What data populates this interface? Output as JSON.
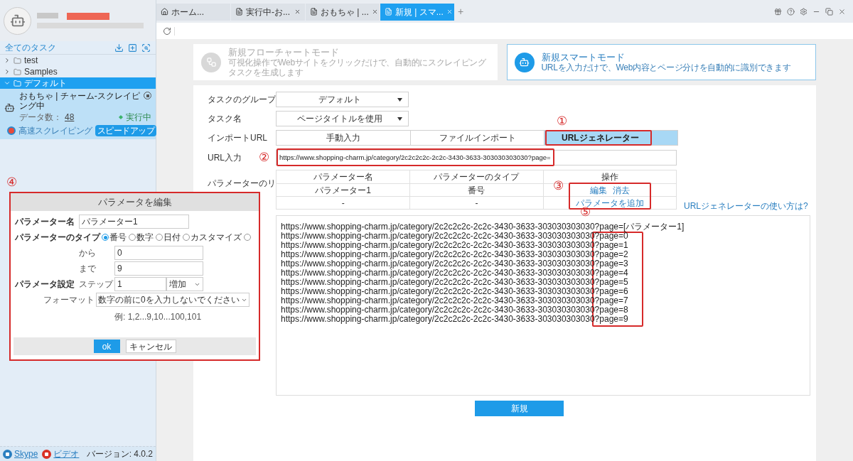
{
  "tabs": [
    {
      "label": "ホーム...",
      "kind": "home",
      "closable": false,
      "selected": false
    },
    {
      "label": "実行中-お...",
      "kind": "page",
      "closable": true,
      "selected": false
    },
    {
      "label": "おもちゃ | ...",
      "kind": "page",
      "closable": true,
      "selected": false
    },
    {
      "label": "新規 | スマ...",
      "kind": "page",
      "closable": true,
      "selected": true
    }
  ],
  "new_tab": "+",
  "sidebar": {
    "title": "全てのタスク",
    "folders": [
      {
        "label": "test",
        "expanded": false,
        "selected": false
      },
      {
        "label": "Samples",
        "expanded": false,
        "selected": false
      },
      {
        "label": "デフォルト",
        "expanded": true,
        "selected": true
      }
    ],
    "task": {
      "title": "おもちゃ | チャーム-スクレイピング中",
      "data_label": "データ数：",
      "data_count": "48",
      "status": "実行中",
      "speed_label": "高速スクレイピング",
      "speed_button": "スピードアップ"
    },
    "footer": {
      "links": [
        "Skype",
        "ビデオ"
      ],
      "version": "バージョン: 4.0.2"
    }
  },
  "modes": [
    {
      "title": "新規フローチャートモード",
      "subtitle": "可視化操作でWebサイトをクリックだけで、自動的にスクレイピングタスクを生成します",
      "selected": false
    },
    {
      "title": "新規スマートモード",
      "subtitle": "URLを入力だけで、Web内容とページ分けを自動的に識別できます",
      "selected": true
    }
  ],
  "form": {
    "group": {
      "label": "タスクのグループ",
      "value": "デフォルト"
    },
    "task_name": {
      "label": "タスク名",
      "value": "ページタイトルを使用"
    },
    "import_url": {
      "label": "インポートURL",
      "options": [
        {
          "label": "手動入力",
          "selected": false
        },
        {
          "label": "ファイルインポート",
          "selected": false
        },
        {
          "label": "URLジェネレーター",
          "selected": true
        }
      ]
    },
    "url_input": {
      "label": "URL入力",
      "value": "https://www.shopping-charm.jp/category/2c2c2c2c-2c2c-3430-3633-303030303030?page="
    },
    "params": {
      "label": "パラメーターのリ",
      "columns": [
        "パラメーター名",
        "パラメーターのタイプ",
        "操作"
      ],
      "rows": [
        {
          "cells": [
            "パラメーター1",
            "番号"
          ],
          "actions": [
            "編集",
            "消去"
          ]
        },
        {
          "cells": [
            "-",
            "-"
          ],
          "actions": [
            "パラメータを追加"
          ]
        }
      ]
    },
    "help_link": "URLジェネレーターの使い方は?",
    "output_lines": [
      "https://www.shopping-charm.jp/category/2c2c2c2c-2c2c-3430-3633-303030303030?page=[パラメーター1]",
      "https://www.shopping-charm.jp/category/2c2c2c2c-2c2c-3430-3633-303030303030?page=0",
      "https://www.shopping-charm.jp/category/2c2c2c2c-2c2c-3430-3633-303030303030?page=1",
      "https://www.shopping-charm.jp/category/2c2c2c2c-2c2c-3430-3633-303030303030?page=2",
      "https://www.shopping-charm.jp/category/2c2c2c2c-2c2c-3430-3633-303030303030?page=3",
      "https://www.shopping-charm.jp/category/2c2c2c2c-2c2c-3430-3633-303030303030?page=4",
      "https://www.shopping-charm.jp/category/2c2c2c2c-2c2c-3430-3633-303030303030?page=5",
      "https://www.shopping-charm.jp/category/2c2c2c2c-2c2c-3430-3633-303030303030?page=6",
      "https://www.shopping-charm.jp/category/2c2c2c2c-2c2c-3430-3633-303030303030?page=7",
      "https://www.shopping-charm.jp/category/2c2c2c2c-2c2c-3430-3633-303030303030?page=8",
      "https://www.shopping-charm.jp/category/2c2c2c2c-2c2c-3430-3633-303030303030?page=9"
    ],
    "create_button": "新規"
  },
  "dialog": {
    "title": "パラメータを編集",
    "name_label": "パラメーター名",
    "name_value": "パラメーター1",
    "type_label": "パラメーターのタイプ",
    "types": [
      {
        "label": "番号",
        "selected": true
      },
      {
        "label": "数字",
        "selected": false
      },
      {
        "label": "日付",
        "selected": false
      },
      {
        "label": "カスタマイズ",
        "selected": false
      },
      {
        "selected": false
      }
    ],
    "settings_label": "パラメータ設定",
    "from_label": "から",
    "from_value": "0",
    "to_label": "まで",
    "to_value": "9",
    "step_label": "ステップ",
    "step_value": "1",
    "direction": "増加",
    "format_label": "フォーマット",
    "format_value": "数字の前に0を入力しないでください",
    "example": "例: 1,2...9,10...100,101",
    "ok": "ok",
    "cancel": "キャンセル"
  },
  "annotations": [
    "①",
    "②",
    "③",
    "④",
    "⑤"
  ]
}
